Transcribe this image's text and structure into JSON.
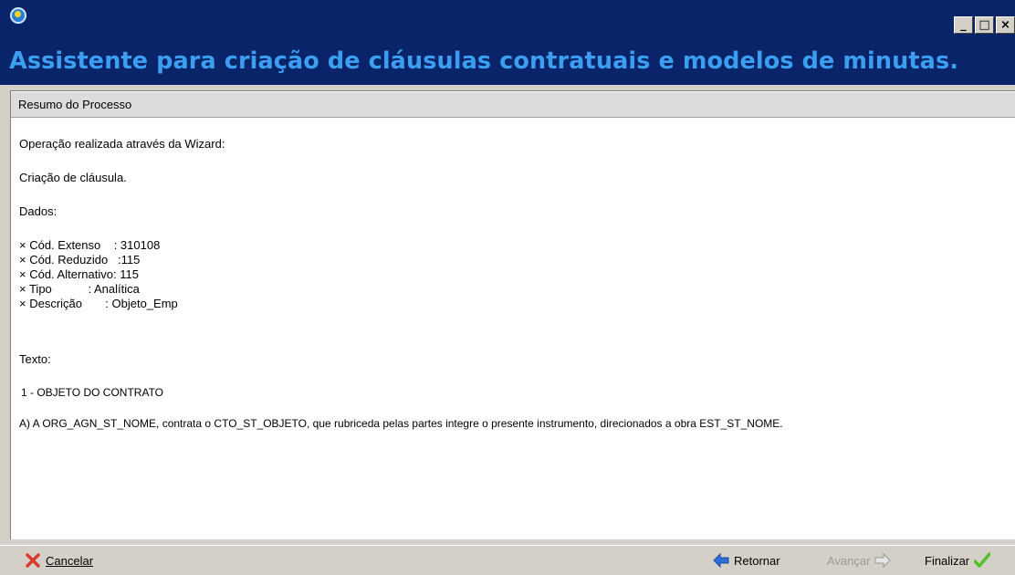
{
  "window": {
    "controls": [
      "_",
      "□",
      "×"
    ]
  },
  "header": {
    "title": "Assistente para criação de cláusulas contratuais e modelos de minutas."
  },
  "section": {
    "title": "Resumo do Processo"
  },
  "summary": {
    "operation_label": "Operação realizada através da Wizard:",
    "operation_value": "Criação de cláusula.",
    "data_label": "Dados:",
    "fields": [
      "× Cód. Extenso    : 310108",
      "× Cód. Reduzido   :115",
      "× Cód. Alternativo: 115",
      "× Tipo           : Analítica",
      "× Descrição       : Objeto_Emp"
    ],
    "text_label": "Texto:",
    "text_heading": "1 - OBJETO DO CONTRATO",
    "text_body": "A) A ORG_AGN_ST_NOME, contrata o CTO_ST_OBJETO, que rubriceda pelas partes integre o presente instrumento, direcionados a obra EST_ST_NOME."
  },
  "footer": {
    "cancel_label": "Cancelar",
    "back_label": "Retornar",
    "next_label": "Avançar",
    "finish_label": "Finalizar"
  },
  "colors": {
    "title_bar": "#0a246a",
    "title_text": "#3b9ef0",
    "cancel_icon": "#d9392b",
    "back_icon": "#2b6fd6",
    "finish_icon": "#4fc12a"
  }
}
